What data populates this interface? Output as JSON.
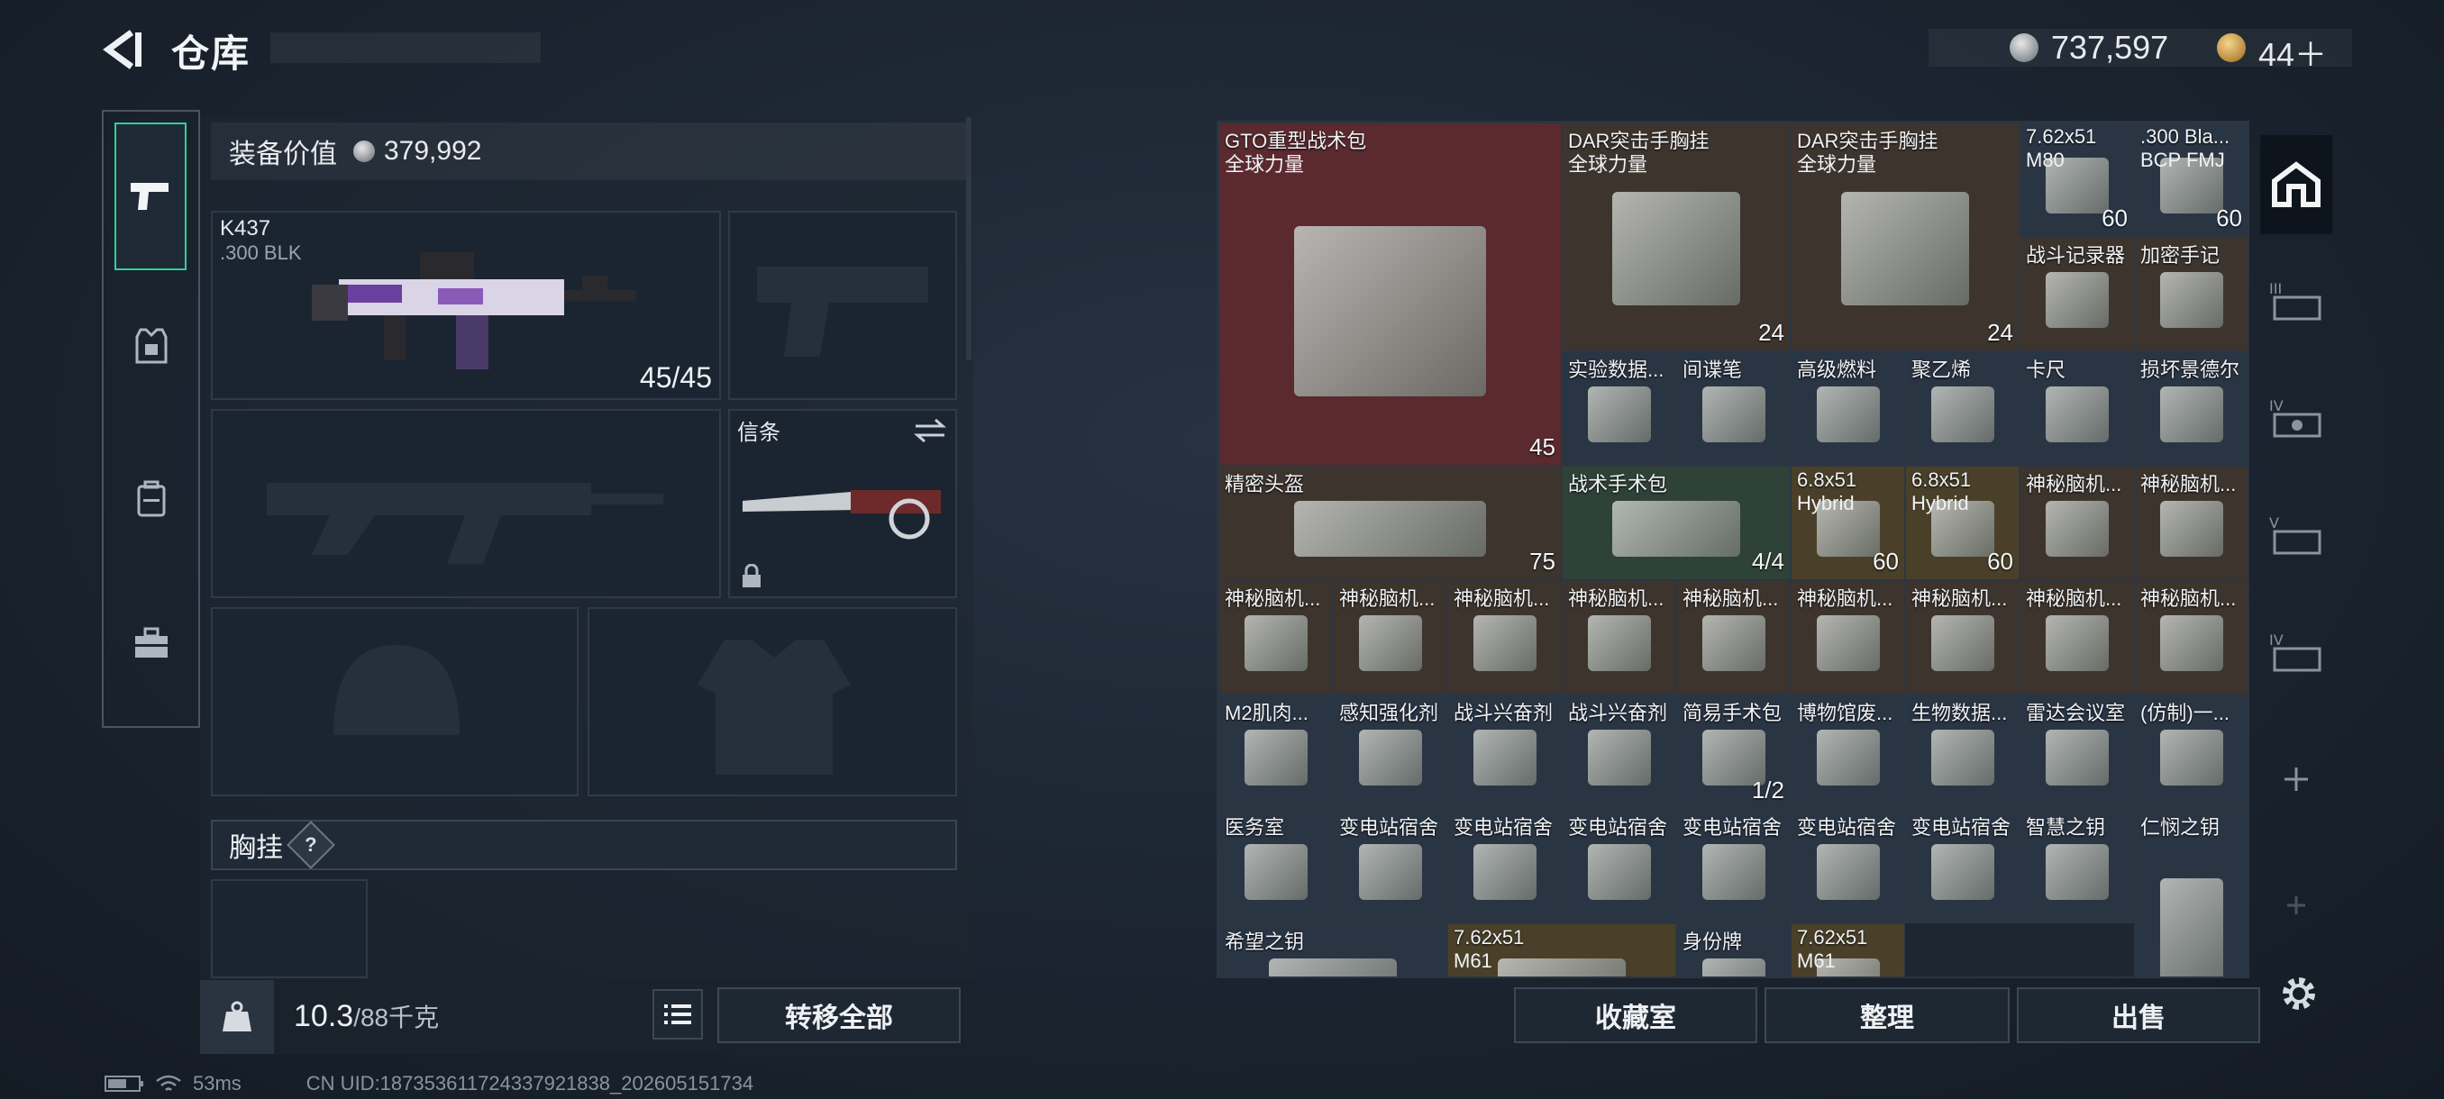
{
  "header": {
    "title": "仓库",
    "currency_value": "737,597",
    "tokens_value": "44＋"
  },
  "loadout": {
    "value_label": "装备价值",
    "value": "379,992",
    "weapon": {
      "name": "K437",
      "ammo_type": ".300 BLK",
      "ammo": "45/45"
    },
    "melee_label": "信条",
    "section_title": "胸挂",
    "section_help": "?",
    "weight": "10.3",
    "weight_unit": "/88千克",
    "transfer_all": "转移全部"
  },
  "stash": {
    "items": [
      {
        "name": "GTO重型战术包",
        "sub": "全球力量",
        "count": "45",
        "tint": "red"
      },
      {
        "name": "DAR突击手胸挂",
        "sub": "全球力量",
        "count": "24",
        "tint": "brown"
      },
      {
        "name": "DAR突击手胸挂",
        "sub": "全球力量",
        "count": "24",
        "tint": "brown"
      },
      {
        "name": "7.62x51",
        "sub": "M80",
        "count": "60",
        "tint": "slate"
      },
      {
        "name": ".300 Bla...",
        "sub": "BCP FMJ",
        "count": "60",
        "tint": "slate"
      },
      {
        "name": "战斗记录器",
        "tint": "brown"
      },
      {
        "name": "加密手记",
        "tint": "brown"
      },
      {
        "name": "实验数据...",
        "tint": "slate"
      },
      {
        "name": "间谍笔",
        "tint": "slate"
      },
      {
        "name": "高级燃料",
        "tint": "slate"
      },
      {
        "name": "聚乙烯",
        "tint": "slate"
      },
      {
        "name": "卡尺",
        "tint": "slate"
      },
      {
        "name": "损坏景德尔",
        "tint": "slate"
      },
      {
        "name": "精密头盔",
        "count": "75",
        "tint": "brown"
      },
      {
        "name": "战术手术包",
        "count": "4/4",
        "tint": "green"
      },
      {
        "name": "6.8x51",
        "sub": "Hybrid",
        "count": "60",
        "tint": "gold"
      },
      {
        "name": "6.8x51",
        "sub": "Hybrid",
        "count": "60",
        "tint": "gold"
      },
      {
        "name": "神秘脑机...",
        "tint": "brown"
      },
      {
        "name": "神秘脑机...",
        "tint": "brown"
      },
      {
        "name": "神秘脑机...",
        "tint": "brown"
      },
      {
        "name": "神秘脑机...",
        "tint": "brown"
      },
      {
        "name": "神秘脑机...",
        "tint": "brown"
      },
      {
        "name": "神秘脑机...",
        "tint": "brown"
      },
      {
        "name": "神秘脑机...",
        "tint": "brown"
      },
      {
        "name": "神秘脑机...",
        "tint": "brown"
      },
      {
        "name": "神秘脑机...",
        "tint": "brown"
      },
      {
        "name": "神秘脑机...",
        "tint": "brown"
      },
      {
        "name": "神秘脑机...",
        "tint": "brown"
      },
      {
        "name": "M2肌肉...",
        "tint": "slate"
      },
      {
        "name": "感知强化剂",
        "tint": "slate"
      },
      {
        "name": "战斗兴奋剂",
        "tint": "slate"
      },
      {
        "name": "战斗兴奋剂",
        "tint": "slate"
      },
      {
        "name": "简易手术包",
        "count": "1/2",
        "tint": "slate"
      },
      {
        "name": "博物馆废...",
        "tint": "slate"
      },
      {
        "name": "生物数据...",
        "tint": "slate"
      },
      {
        "name": "雷达会议室",
        "tint": "slate"
      },
      {
        "name": "(仿制)一...",
        "tint": "slate"
      },
      {
        "name": "医务室",
        "tint": "slate"
      },
      {
        "name": "变电站宿舍",
        "tint": "slate"
      },
      {
        "name": "变电站宿舍",
        "tint": "slate"
      },
      {
        "name": "变电站宿舍",
        "tint": "slate"
      },
      {
        "name": "变电站宿舍",
        "tint": "slate"
      },
      {
        "name": "变电站宿舍",
        "tint": "slate"
      },
      {
        "name": "变电站宿舍",
        "tint": "slate"
      },
      {
        "name": "智慧之钥",
        "tint": "slate"
      },
      {
        "name": "仁悯之钥",
        "tint": "slate"
      },
      {
        "name": "希望之钥",
        "tint": "slate"
      },
      {
        "name": "7.62x51",
        "sub": "M61",
        "tint": "gold"
      },
      {
        "name": "身份牌",
        "tint": "slate"
      },
      {
        "name": "7.62x51",
        "sub": "M61",
        "tint": "gold"
      }
    ],
    "buttons": {
      "collection": "收藏室",
      "sort": "整理",
      "sell": "出售"
    }
  },
  "status": {
    "ping": "53ms",
    "uid": "CN UID:187353611724337921838_202605151734"
  },
  "colors": {
    "accent": "#2fd19a",
    "tint_red": "#5a2a2f",
    "tint_green": "#2f4238",
    "tint_gold": "#4a4029"
  }
}
